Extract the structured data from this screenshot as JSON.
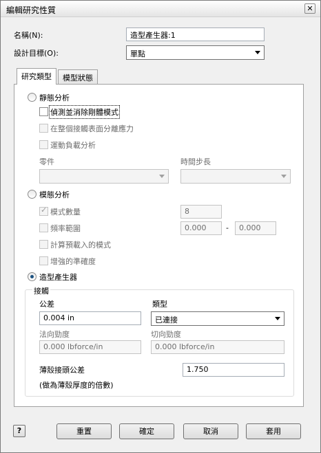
{
  "window": {
    "title": "編輯研究性質",
    "close_glyph": "✕"
  },
  "header": {
    "name_label": "名稱(N):",
    "name_value": "造型產生器:1",
    "goal_label": "設計目標(O):",
    "goal_value": "單點"
  },
  "tabs": [
    {
      "label": "研究類型"
    },
    {
      "label": "模型狀態"
    }
  ],
  "static": {
    "label": "靜態分析",
    "detect_rigid": "偵測並消除剛體模式",
    "separate_stress": "在整個接觸表面分離應力",
    "motion_load": "運動負載分析",
    "part_label": "零件",
    "time_step_label": "時間步長"
  },
  "modal": {
    "label": "模態分析",
    "mode_count_label": "模式數量",
    "mode_count_value": "8",
    "freq_range_label": "頻率範圍",
    "freq_min": "0.000",
    "freq_sep": "-",
    "freq_max": "0.000",
    "preload_label": "計算預載入的模式",
    "enhanced_label": "增強的準確度"
  },
  "shape": {
    "label": "造型產生器"
  },
  "contact": {
    "group_title": "接觸",
    "tolerance_label": "公差",
    "tolerance_value": "0.004 in",
    "type_label": "類型",
    "type_value": "已連接",
    "normal_label": "法向勁度",
    "normal_value": "0.000 lbforce/in",
    "tangent_label": "切向勁度",
    "tangent_value": "0.000 lbforce/in",
    "shell_label": "薄殼接頭公差",
    "shell_value": "1.750",
    "shell_note": "(做為薄殼厚度的倍數)"
  },
  "buttons": {
    "help": "?",
    "reset": "重置",
    "ok": "確定",
    "cancel": "取消",
    "apply": "套用"
  }
}
